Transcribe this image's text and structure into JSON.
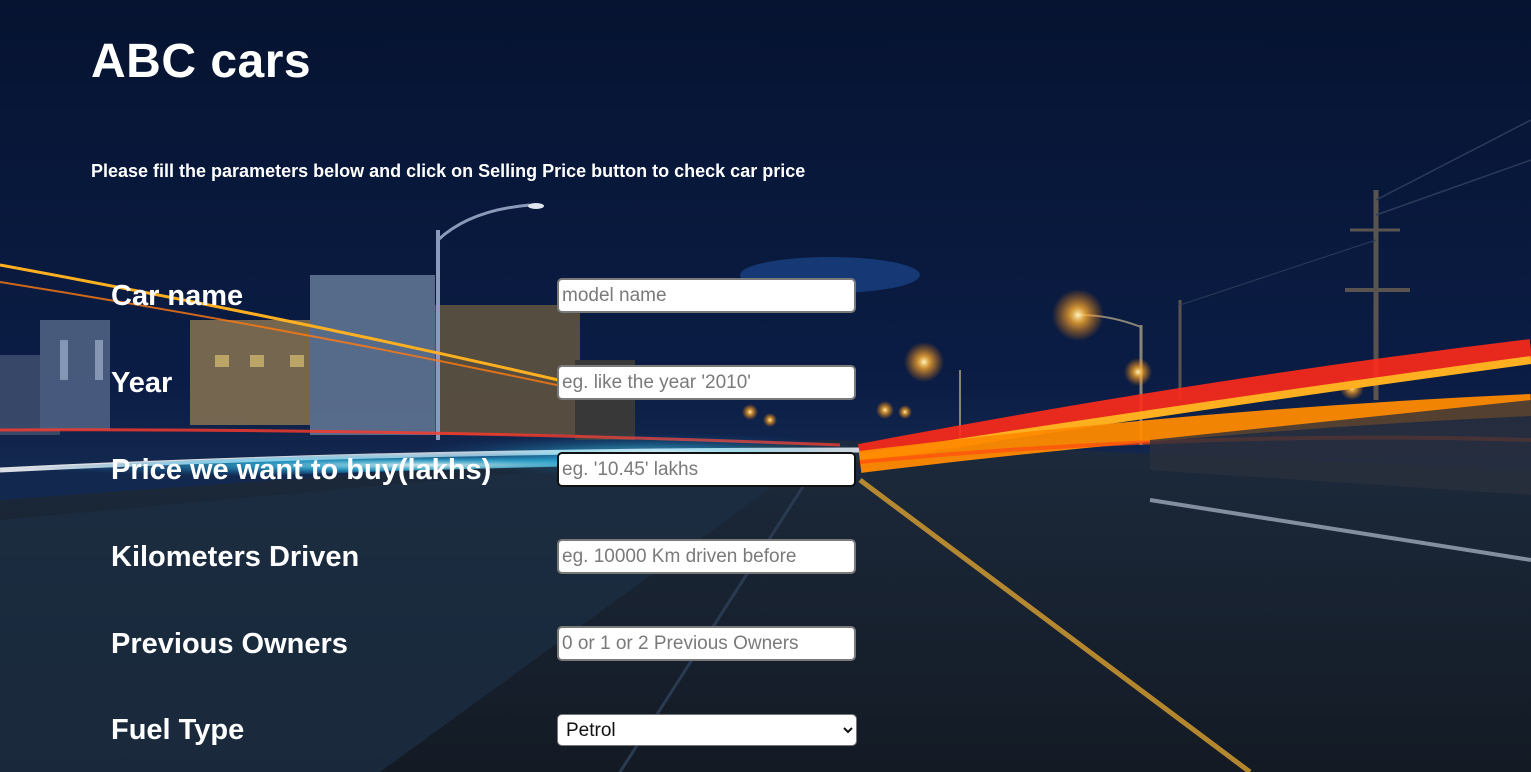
{
  "page": {
    "title": "ABC cars",
    "subtitle": "Please fill the parameters below and click on Selling Price button to check car price"
  },
  "form": {
    "car_name": {
      "label": "Car name",
      "placeholder": "model name"
    },
    "year": {
      "label": "Year",
      "placeholder": "eg. like the year '2010'"
    },
    "price": {
      "label": "Price we want to buy(lakhs)",
      "placeholder": "eg. '10.45' lakhs"
    },
    "kms": {
      "label": "Kilometers Driven",
      "placeholder": "eg. 10000 Km driven before"
    },
    "owners": {
      "label": "Previous Owners",
      "placeholder": "0 or 1 or 2 Previous Owners"
    },
    "fuel": {
      "label": "Fuel Type",
      "selected": "Petrol",
      "options": [
        "Petrol"
      ]
    }
  },
  "colors": {
    "sky": "#071634",
    "light_trail_orange": "#ff8a00",
    "light_trail_red": "#ff2a1a",
    "light_trail_cyan": "#3ad8ff"
  }
}
